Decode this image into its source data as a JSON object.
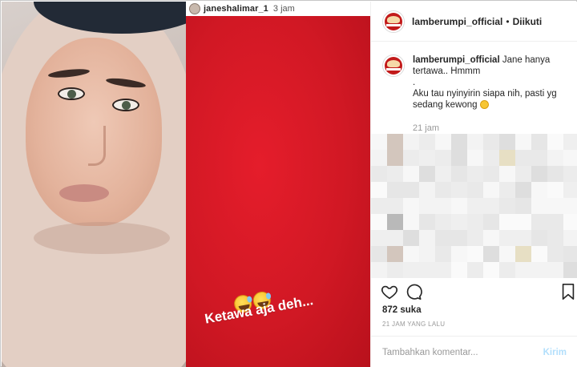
{
  "story": {
    "username": "janeshalimar_1",
    "time": "3 jam",
    "text": "Ketawa aja deh...",
    "emoji": [
      "grinning-sweat-emoji",
      "grinning-sweat-emoji"
    ],
    "background_color": "#d11824"
  },
  "post": {
    "username": "lamberumpi_official",
    "separator": "•",
    "follow_status": "Diikuti",
    "caption": {
      "username": "lamberumpi_official",
      "line1": "Jane hanya tertawa.. Hmmm",
      "line2": ".",
      "line3": "Aku tau nyinyirin siapa nih, pasti yg sedang kewong",
      "emoji": "sad-face-emoji",
      "time": "21 jam"
    },
    "likes": "872 suka",
    "timestamp": "21 JAM YANG LALU",
    "comment": {
      "placeholder": "Tambahkan komentar...",
      "post_label": "Kirim"
    }
  },
  "icons": {
    "heart": "heart-icon",
    "comment": "comment-icon",
    "save": "bookmark-icon"
  },
  "colors": {
    "link_disabled": "#b2dffc",
    "text": "#262626",
    "muted": "#999999"
  }
}
